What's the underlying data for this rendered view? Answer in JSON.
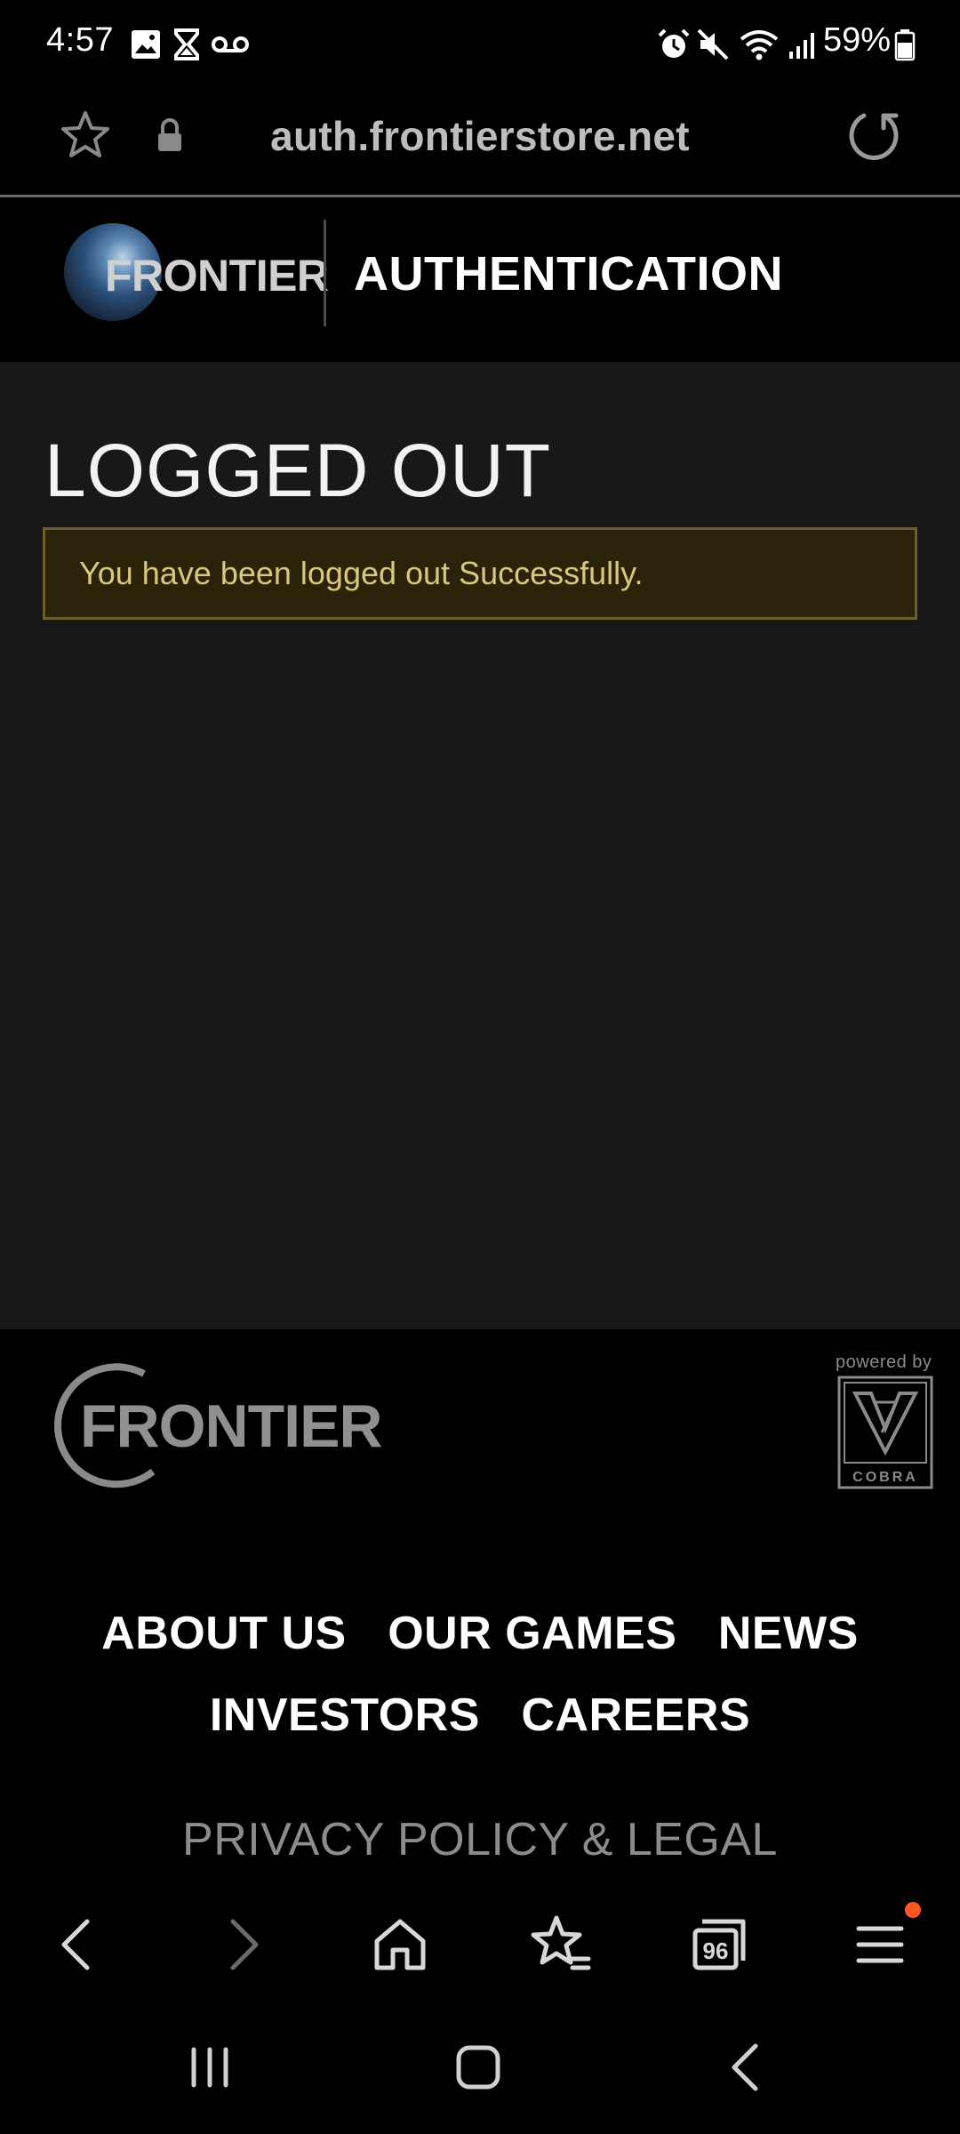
{
  "status_bar": {
    "time": "4:57",
    "battery": "59%"
  },
  "browser": {
    "url": "auth.frontierstore.net"
  },
  "header": {
    "logo_text": "FRONTIER",
    "title": "AUTHENTICATION"
  },
  "main": {
    "page_title": "LOGGED OUT",
    "alert_message": "You have been logged out Successfully."
  },
  "footer": {
    "logo_text": "FRONTIER",
    "powered_by": "powered by",
    "cobra_label": "COBRA",
    "nav_row_1": [
      "ABOUT US",
      "OUR GAMES",
      "NEWS"
    ],
    "nav_row_2": [
      "INVESTORS",
      "CAREERS"
    ],
    "privacy": "PRIVACY POLICY & LEGAL"
  },
  "toolbar": {
    "tabs_count": "96"
  },
  "colors": {
    "alert_bg": "#2a2209",
    "alert_border": "#6c5f25",
    "alert_text": "#d7c87d",
    "main_bg": "#181818",
    "menu_badge": "#ff5722"
  }
}
